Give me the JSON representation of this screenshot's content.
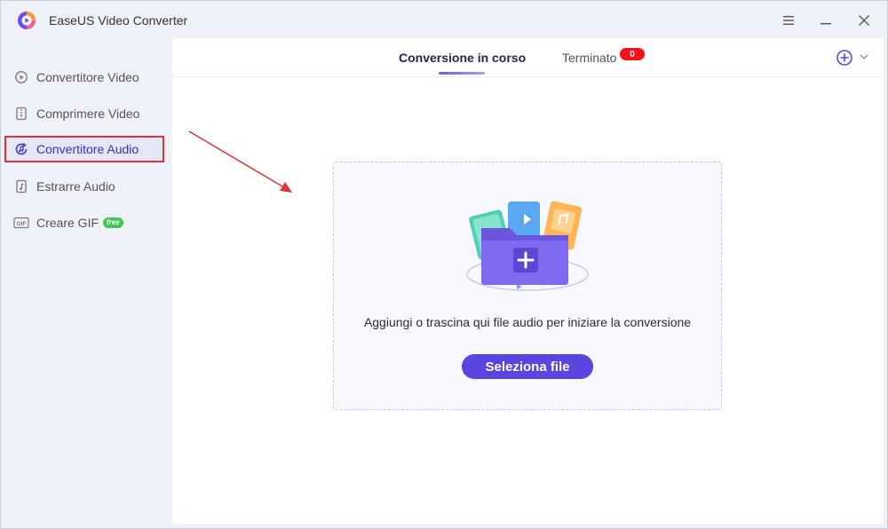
{
  "app": {
    "title": "EaseUS Video Converter",
    "accent_color": "#5a45e0",
    "icons": {
      "logo": "app-logo-icon",
      "menu": "menu-icon",
      "minimize": "minimize-icon",
      "close": "close-icon"
    }
  },
  "sidebar": {
    "items": [
      {
        "label": "Convertitore Video",
        "icon": "video-convert-icon",
        "active": false
      },
      {
        "label": "Comprimere Video",
        "icon": "compress-icon",
        "active": false
      },
      {
        "label": "Convertitore Audio",
        "icon": "audio-convert-icon",
        "active": true
      },
      {
        "label": "Estrarre Audio",
        "icon": "extract-audio-icon",
        "active": false
      },
      {
        "label": "Creare GIF",
        "icon": "gif-icon",
        "badge": "free",
        "active": false
      }
    ],
    "highlight_color": "#e0323c"
  },
  "tabs": {
    "active_label": "Conversione in corso",
    "inactive_label": "Terminato",
    "finished_count": "0",
    "badge_color": "#f5121d"
  },
  "dropzone": {
    "instruction": "Aggiungi o trascina qui file audio per iniziare la conversione",
    "button_label": "Seleziona file",
    "illustration": "folder-add-icon"
  }
}
